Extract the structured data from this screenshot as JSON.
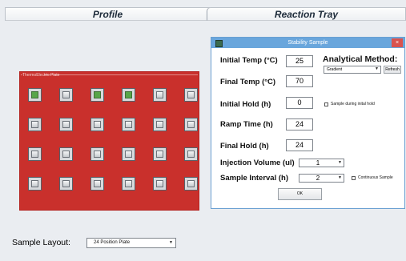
{
  "tabs": {
    "profile": "Profile",
    "reaction_tray": "Reaction Tray"
  },
  "plate": {
    "label": "ThermoElectric Plate",
    "rows": 4,
    "cols": 6,
    "filled_wells": [
      0,
      2,
      3
    ],
    "colors": {
      "plate": "#c9302c",
      "filled_well": "#57a548"
    }
  },
  "dialog": {
    "title": "Stability Sample",
    "close_glyph": "×",
    "fields": {
      "initial_temp_label": "Initial Temp (°C)",
      "initial_temp_value": "25",
      "final_temp_label": "Final Temp (°C)",
      "final_temp_value": "70",
      "initial_hold_label": "Initial Hold (h)",
      "initial_hold_value": "0",
      "ramp_time_label": "Ramp Time (h)",
      "ramp_time_value": "24",
      "final_hold_label": "Final Hold (h)",
      "final_hold_value": "24",
      "injection_volume_label": "Injection Volume (ul)",
      "injection_volume_value": "1",
      "sample_interval_label": "Sample Interval (h)",
      "sample_interval_value": "2"
    },
    "analytical_method_label": "Analytical Method:",
    "analytical_method_value": "Gradient",
    "refresh_label": "Refresh",
    "sample_during_hold_label": "Sample during inital hold",
    "continuous_sample_label": "Continuous Sample",
    "ok_label": "OK"
  },
  "sample_layout": {
    "label": "Sample Layout:",
    "value": "24 Position Plate"
  }
}
